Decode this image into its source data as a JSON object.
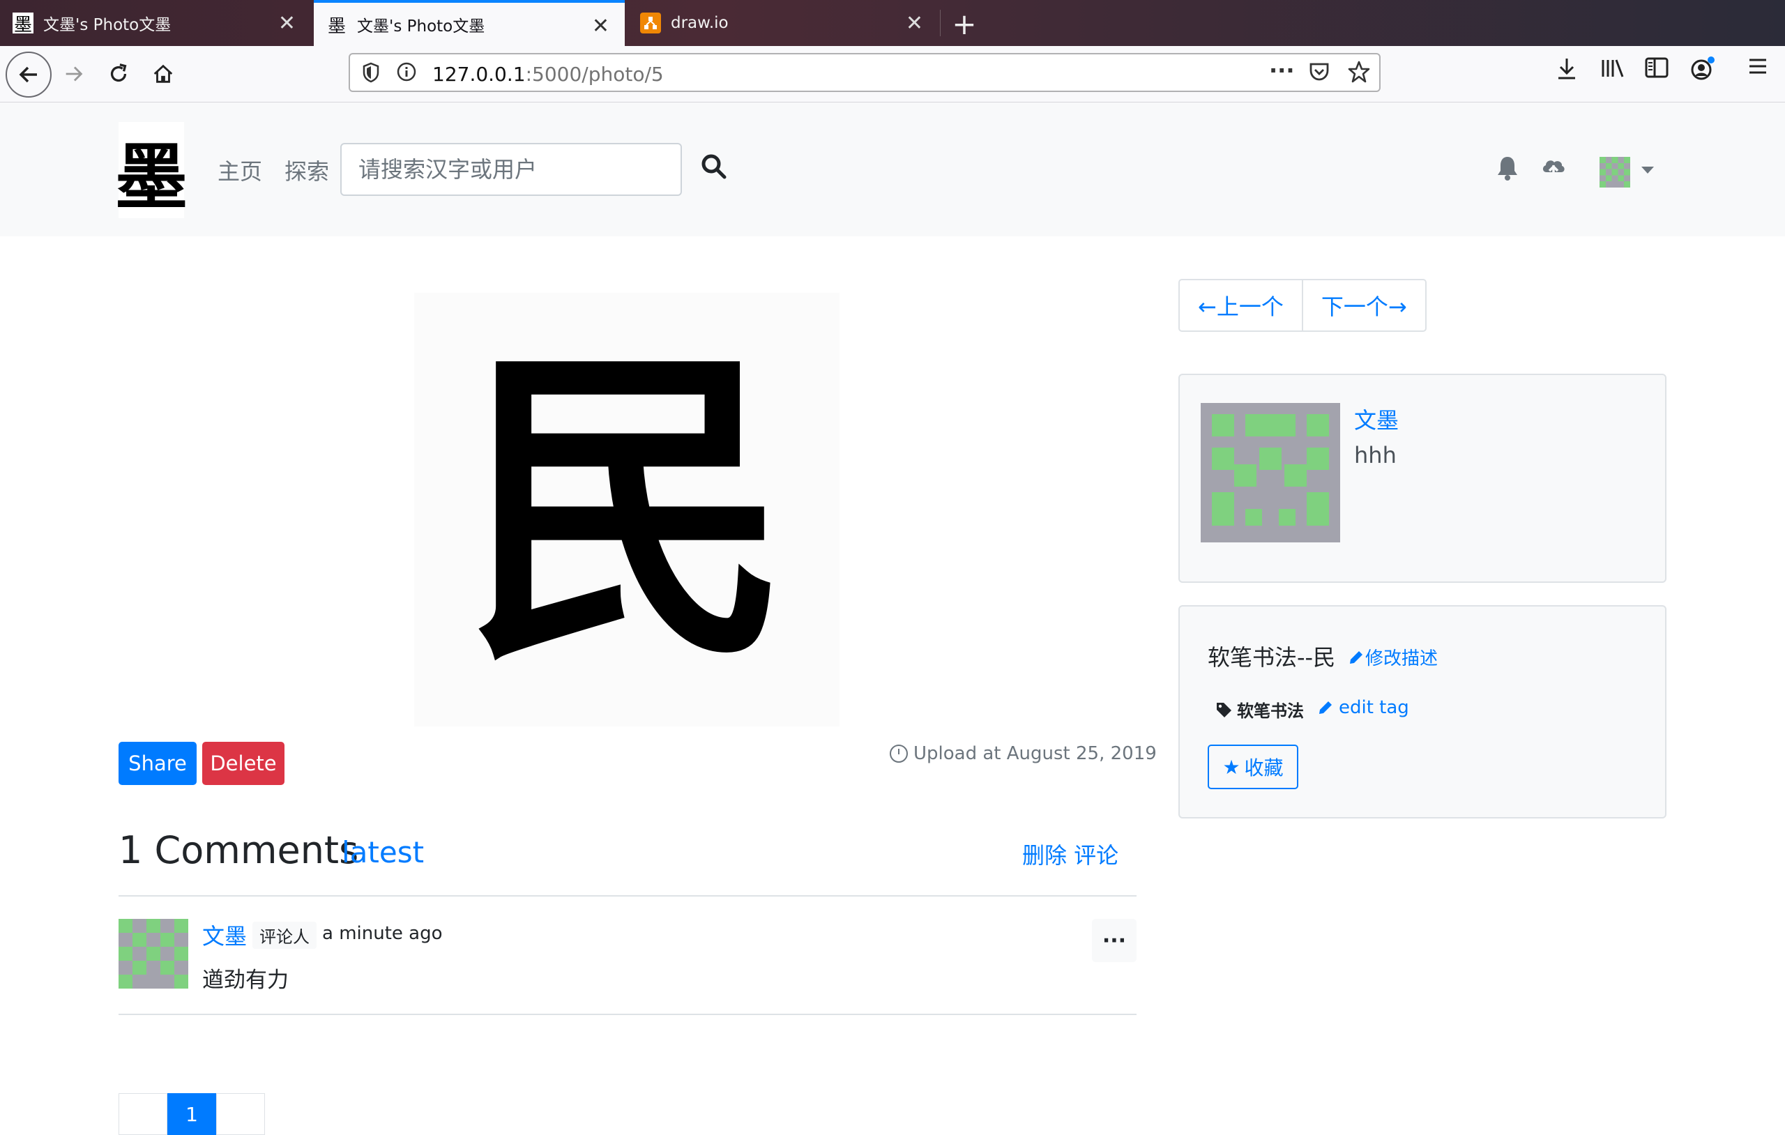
{
  "browser": {
    "tabs": [
      {
        "title": "文墨's Photo文墨",
        "favicon": "墨",
        "active": false
      },
      {
        "title": "文墨's Photo文墨",
        "favicon": "墨",
        "active": true
      },
      {
        "title": "draw.io",
        "favicon": "drawio-icon",
        "active": false
      }
    ],
    "url_host": "127.0.0.1",
    "url_path": ":5000/photo/5",
    "accent": "#0a84ff"
  },
  "site": {
    "logo_char": "墨",
    "nav": {
      "home": "主页",
      "explore": "探索"
    },
    "search_placeholder": "请搜索汉字或用户"
  },
  "photo": {
    "character": "民",
    "share_label": "Share",
    "delete_label": "Delete",
    "upload_text": "Upload at August 25, 2019"
  },
  "comments": {
    "heading": "1 Comments",
    "latest_label": "latest",
    "delete_all_label": "删除 评论",
    "items": [
      {
        "user": "文墨",
        "badge": "评论人",
        "time": "a minute ago",
        "body": "遒劲有力"
      }
    ]
  },
  "pagination": {
    "pages": [
      "1"
    ],
    "current": "1"
  },
  "sidebar": {
    "prev_label": "←上一个",
    "next_label": "下一个→",
    "author_name": "文墨",
    "author_bio": "hhh",
    "description": "软笔书法--民",
    "edit_description_label": "修改描述",
    "tag": "软笔书法",
    "edit_tag_label": "edit tag",
    "collect_label": "收藏"
  },
  "colors": {
    "primary": "#007bff",
    "danger": "#dc3545",
    "avatar_green": "#7fd17f",
    "avatar_gray": "#a3a3ad"
  }
}
